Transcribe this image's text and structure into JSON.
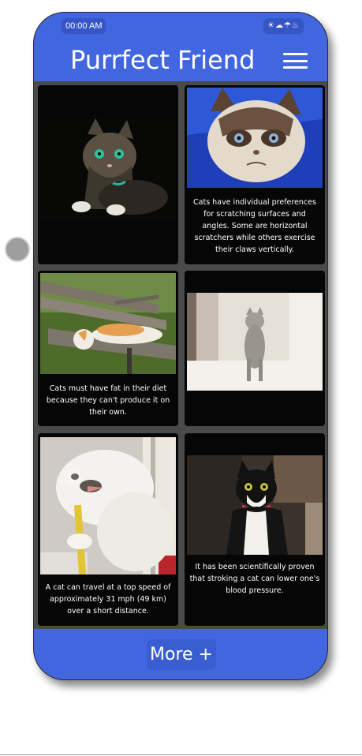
{
  "status_bar": {
    "time": "00:00 AM",
    "icons": "☀☁☂♨"
  },
  "header": {
    "title": "Purrfect Friend",
    "menu_icon": "hamburger-menu-icon"
  },
  "cards": [
    {
      "image": "tabby-cat-green-eyes-photo",
      "caption": ""
    },
    {
      "image": "grumpy-cat-photo",
      "caption": "Cats have individual preferences for scratching surfaces and angles. Some are horizontal scratchers while others exercise their claws vertically."
    },
    {
      "image": "cat-on-bench-photo",
      "caption": "Cats must have fat in their diet because they can't produce it on their own."
    },
    {
      "image": "gray-kitten-walking-photo",
      "caption": ""
    },
    {
      "image": "white-cat-chewing-photo",
      "caption": "A cat can travel at a top speed of approximately 31 mph (49 km) over a short distance."
    },
    {
      "image": "tuxedo-cat-photo",
      "caption": "It has been scientifically proven that stroking a cat can lower one's blood pressure."
    }
  ],
  "footer": {
    "more_label": "More +"
  },
  "colors": {
    "brand": "#4166e0",
    "card": "#060606",
    "grid_bg": "#4a4a4a"
  }
}
